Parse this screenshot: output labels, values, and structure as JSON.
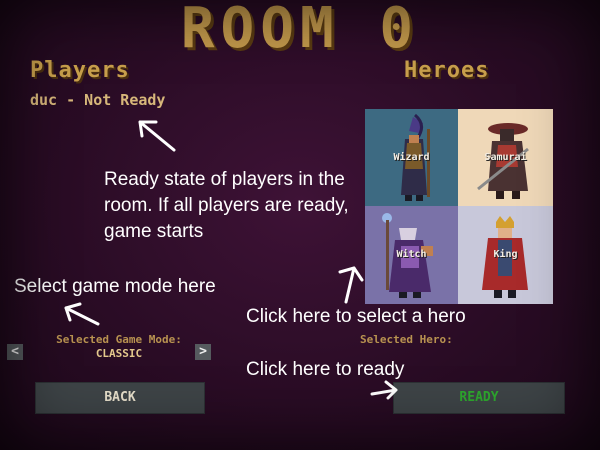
{
  "room": {
    "title": "ROOM 0"
  },
  "players": {
    "title": "Players",
    "list": [
      {
        "label": "duc - Not Ready"
      }
    ]
  },
  "heroes": {
    "title": "Heroes",
    "items": [
      {
        "name": "Wizard",
        "bg": "#3d6a82"
      },
      {
        "name": "Samurai",
        "bg": "#efd8b8"
      },
      {
        "name": "Witch",
        "bg": "#7a72a8"
      },
      {
        "name": "King",
        "bg": "#c8c8da"
      }
    ],
    "selected_label": "Selected Hero:"
  },
  "game_mode": {
    "label": "Selected Game Mode:",
    "value": "CLASSIC",
    "prev_icon": "<",
    "next_icon": ">"
  },
  "buttons": {
    "back": "BACK",
    "ready": "READY"
  },
  "annotations": {
    "ready_state": "Ready state of players in the room. If all players are ready, game starts",
    "select_mode": "Select game mode here",
    "select_hero": "Click here to select a hero",
    "click_ready": "Click here to ready"
  },
  "colors": {
    "title": "#c49a4c",
    "ready_text": "#2ea82e",
    "button_bg": "#3e4447",
    "background": "#2a0c25"
  }
}
